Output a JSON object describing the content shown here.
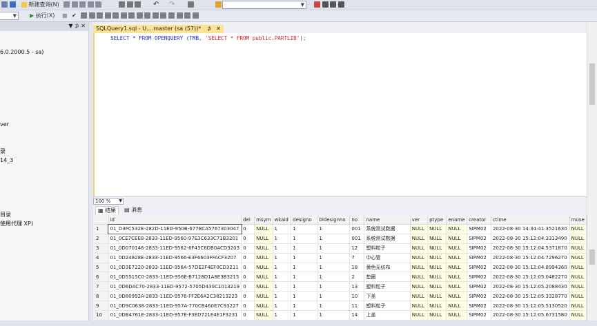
{
  "toolbar1": {
    "new_query": "新建查询(N)"
  },
  "toolbar2": {
    "execute": "执行(X)"
  },
  "object_explorer": {
    "pin": "▼ ⊅ ✕",
    "lines": [
      "6.0.2000.5 - sa)",
      "ver",
      "录",
      "14_3",
      "目录",
      "使用代理 XP)"
    ]
  },
  "editor": {
    "tab_label": "SQLQuery1.sql - U....master (sa (57))*",
    "tab_pin": "⊅",
    "tab_close": "✕",
    "sql": {
      "part1": "SELECT * FROM OPENQUERY (TMB, ",
      "part2": "'SELECT * FROM public.PARTLIB'",
      "part3": ");"
    },
    "zoom": "100 %"
  },
  "results": {
    "tab_results": "结果",
    "tab_messages": "消息",
    "columns": [
      "",
      "id",
      "del",
      "msym",
      "wkaid",
      "designo",
      "bldesignno",
      "no",
      "name",
      "ver",
      "ptype",
      "ename",
      "creator",
      "ctime",
      "muse"
    ],
    "rows": [
      [
        "1",
        "01_D3FC532E-282D-11ED-950B-677BCA5767303047",
        "0",
        "NULL",
        "1",
        "1",
        "1",
        "001",
        "系统测试数据",
        "NULL",
        "NULL",
        "NULL",
        "SIPM02",
        "2022-08-30 14:34:41.3521630",
        "NULL"
      ],
      [
        "2",
        "01_0CE7CEE8-2833-11ED-9560-97E3C633C71B3201",
        "0",
        "NULL",
        "1",
        "1",
        "1",
        "001",
        "系统测试数据",
        "NULL",
        "NULL",
        "NULL",
        "SIPM02",
        "2022-08-30 15:12:04.3313490",
        "NULL"
      ],
      [
        "3",
        "01_0D070146-2833-11ED-9562-6F43C6DB0ACD3203",
        "0",
        "NULL",
        "1",
        "1",
        "1",
        "12",
        "塑料粒子",
        "NULL",
        "NULL",
        "NULL",
        "SIPM02",
        "2022-08-30 15:12:04.5371870",
        "NULL"
      ],
      [
        "4",
        "01_0D24828E-2833-11ED-9566-E3F6603FFACF3207",
        "0",
        "NULL",
        "1",
        "1",
        "1",
        "7",
        "中心管",
        "NULL",
        "NULL",
        "NULL",
        "SIPM02",
        "2022-08-30 15:12:04.7296270",
        "NULL"
      ],
      [
        "5",
        "01_0D3E7220-2833-11ED-956A-57DE2F4EF0CD3211",
        "0",
        "NULL",
        "1",
        "1",
        "1",
        "18",
        "黄色无纺布",
        "NULL",
        "NULL",
        "NULL",
        "SIPM02",
        "2022-08-30 15:12:04.8994360",
        "NULL"
      ],
      [
        "6",
        "01_0D5515C0-2833-11ED-956E-B7128D1A8E3B3215",
        "0",
        "NULL",
        "1",
        "1",
        "1",
        "2",
        "垫圈",
        "NULL",
        "NULL",
        "NULL",
        "SIPM02",
        "2022-08-30 15:12:05.0482270",
        "NULL"
      ],
      [
        "7",
        "01_0D6DAC70-2833-11ED-9572-5705D430C1013219",
        "0",
        "NULL",
        "1",
        "1",
        "1",
        "13",
        "塑料粒子",
        "NULL",
        "NULL",
        "NULL",
        "SIPM02",
        "2022-08-30 15:12:05.2088430",
        "NULL"
      ],
      [
        "8",
        "01_0D80992A-2833-11ED-9576-FF2E6A2C38213223",
        "0",
        "NULL",
        "1",
        "1",
        "1",
        "10",
        "下盖",
        "NULL",
        "NULL",
        "NULL",
        "SIPM02",
        "2022-08-30 15:12:05.3328770",
        "NULL"
      ],
      [
        "9",
        "01_0D9C0638-2833-11ED-957A-770CB460E7C93227",
        "0",
        "NULL",
        "1",
        "1",
        "1",
        "11",
        "塑料粒子",
        "NULL",
        "NULL",
        "NULL",
        "SIPM02",
        "2022-08-30 15:12:05.5130520",
        "NULL"
      ],
      [
        "10",
        "01_0DB4761E-2833-11ED-957E-F3ED721E4E1F3231",
        "0",
        "NULL",
        "1",
        "1",
        "1",
        "14",
        "上盖",
        "NULL",
        "NULL",
        "NULL",
        "SIPM02",
        "2022-08-30 15:12:05.6731580",
        "NULL"
      ]
    ]
  },
  "colors": {
    "tab_active": "#fbe395",
    "keyword": "#1c34b5",
    "string": "#d11f1f",
    "null_cell": "#ffffe1"
  }
}
